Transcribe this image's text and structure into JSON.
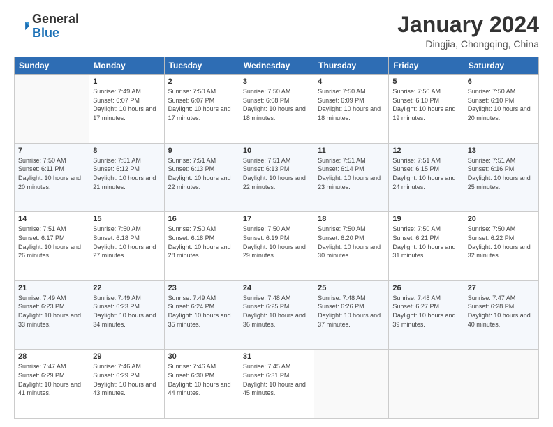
{
  "header": {
    "logo_general": "General",
    "logo_blue": "Blue",
    "month_title": "January 2024",
    "location": "Dingjia, Chongqing, China"
  },
  "days_of_week": [
    "Sunday",
    "Monday",
    "Tuesday",
    "Wednesday",
    "Thursday",
    "Friday",
    "Saturday"
  ],
  "weeks": [
    [
      {
        "day": "",
        "sunrise": "",
        "sunset": "",
        "daylight": ""
      },
      {
        "day": "1",
        "sunrise": "Sunrise: 7:49 AM",
        "sunset": "Sunset: 6:07 PM",
        "daylight": "Daylight: 10 hours and 17 minutes."
      },
      {
        "day": "2",
        "sunrise": "Sunrise: 7:50 AM",
        "sunset": "Sunset: 6:07 PM",
        "daylight": "Daylight: 10 hours and 17 minutes."
      },
      {
        "day": "3",
        "sunrise": "Sunrise: 7:50 AM",
        "sunset": "Sunset: 6:08 PM",
        "daylight": "Daylight: 10 hours and 18 minutes."
      },
      {
        "day": "4",
        "sunrise": "Sunrise: 7:50 AM",
        "sunset": "Sunset: 6:09 PM",
        "daylight": "Daylight: 10 hours and 18 minutes."
      },
      {
        "day": "5",
        "sunrise": "Sunrise: 7:50 AM",
        "sunset": "Sunset: 6:10 PM",
        "daylight": "Daylight: 10 hours and 19 minutes."
      },
      {
        "day": "6",
        "sunrise": "Sunrise: 7:50 AM",
        "sunset": "Sunset: 6:10 PM",
        "daylight": "Daylight: 10 hours and 20 minutes."
      }
    ],
    [
      {
        "day": "7",
        "sunrise": "Sunrise: 7:50 AM",
        "sunset": "Sunset: 6:11 PM",
        "daylight": "Daylight: 10 hours and 20 minutes."
      },
      {
        "day": "8",
        "sunrise": "Sunrise: 7:51 AM",
        "sunset": "Sunset: 6:12 PM",
        "daylight": "Daylight: 10 hours and 21 minutes."
      },
      {
        "day": "9",
        "sunrise": "Sunrise: 7:51 AM",
        "sunset": "Sunset: 6:13 PM",
        "daylight": "Daylight: 10 hours and 22 minutes."
      },
      {
        "day": "10",
        "sunrise": "Sunrise: 7:51 AM",
        "sunset": "Sunset: 6:13 PM",
        "daylight": "Daylight: 10 hours and 22 minutes."
      },
      {
        "day": "11",
        "sunrise": "Sunrise: 7:51 AM",
        "sunset": "Sunset: 6:14 PM",
        "daylight": "Daylight: 10 hours and 23 minutes."
      },
      {
        "day": "12",
        "sunrise": "Sunrise: 7:51 AM",
        "sunset": "Sunset: 6:15 PM",
        "daylight": "Daylight: 10 hours and 24 minutes."
      },
      {
        "day": "13",
        "sunrise": "Sunrise: 7:51 AM",
        "sunset": "Sunset: 6:16 PM",
        "daylight": "Daylight: 10 hours and 25 minutes."
      }
    ],
    [
      {
        "day": "14",
        "sunrise": "Sunrise: 7:51 AM",
        "sunset": "Sunset: 6:17 PM",
        "daylight": "Daylight: 10 hours and 26 minutes."
      },
      {
        "day": "15",
        "sunrise": "Sunrise: 7:50 AM",
        "sunset": "Sunset: 6:18 PM",
        "daylight": "Daylight: 10 hours and 27 minutes."
      },
      {
        "day": "16",
        "sunrise": "Sunrise: 7:50 AM",
        "sunset": "Sunset: 6:18 PM",
        "daylight": "Daylight: 10 hours and 28 minutes."
      },
      {
        "day": "17",
        "sunrise": "Sunrise: 7:50 AM",
        "sunset": "Sunset: 6:19 PM",
        "daylight": "Daylight: 10 hours and 29 minutes."
      },
      {
        "day": "18",
        "sunrise": "Sunrise: 7:50 AM",
        "sunset": "Sunset: 6:20 PM",
        "daylight": "Daylight: 10 hours and 30 minutes."
      },
      {
        "day": "19",
        "sunrise": "Sunrise: 7:50 AM",
        "sunset": "Sunset: 6:21 PM",
        "daylight": "Daylight: 10 hours and 31 minutes."
      },
      {
        "day": "20",
        "sunrise": "Sunrise: 7:50 AM",
        "sunset": "Sunset: 6:22 PM",
        "daylight": "Daylight: 10 hours and 32 minutes."
      }
    ],
    [
      {
        "day": "21",
        "sunrise": "Sunrise: 7:49 AM",
        "sunset": "Sunset: 6:23 PM",
        "daylight": "Daylight: 10 hours and 33 minutes."
      },
      {
        "day": "22",
        "sunrise": "Sunrise: 7:49 AM",
        "sunset": "Sunset: 6:23 PM",
        "daylight": "Daylight: 10 hours and 34 minutes."
      },
      {
        "day": "23",
        "sunrise": "Sunrise: 7:49 AM",
        "sunset": "Sunset: 6:24 PM",
        "daylight": "Daylight: 10 hours and 35 minutes."
      },
      {
        "day": "24",
        "sunrise": "Sunrise: 7:48 AM",
        "sunset": "Sunset: 6:25 PM",
        "daylight": "Daylight: 10 hours and 36 minutes."
      },
      {
        "day": "25",
        "sunrise": "Sunrise: 7:48 AM",
        "sunset": "Sunset: 6:26 PM",
        "daylight": "Daylight: 10 hours and 37 minutes."
      },
      {
        "day": "26",
        "sunrise": "Sunrise: 7:48 AM",
        "sunset": "Sunset: 6:27 PM",
        "daylight": "Daylight: 10 hours and 39 minutes."
      },
      {
        "day": "27",
        "sunrise": "Sunrise: 7:47 AM",
        "sunset": "Sunset: 6:28 PM",
        "daylight": "Daylight: 10 hours and 40 minutes."
      }
    ],
    [
      {
        "day": "28",
        "sunrise": "Sunrise: 7:47 AM",
        "sunset": "Sunset: 6:29 PM",
        "daylight": "Daylight: 10 hours and 41 minutes."
      },
      {
        "day": "29",
        "sunrise": "Sunrise: 7:46 AM",
        "sunset": "Sunset: 6:29 PM",
        "daylight": "Daylight: 10 hours and 43 minutes."
      },
      {
        "day": "30",
        "sunrise": "Sunrise: 7:46 AM",
        "sunset": "Sunset: 6:30 PM",
        "daylight": "Daylight: 10 hours and 44 minutes."
      },
      {
        "day": "31",
        "sunrise": "Sunrise: 7:45 AM",
        "sunset": "Sunset: 6:31 PM",
        "daylight": "Daylight: 10 hours and 45 minutes."
      },
      {
        "day": "",
        "sunrise": "",
        "sunset": "",
        "daylight": ""
      },
      {
        "day": "",
        "sunrise": "",
        "sunset": "",
        "daylight": ""
      },
      {
        "day": "",
        "sunrise": "",
        "sunset": "",
        "daylight": ""
      }
    ]
  ]
}
